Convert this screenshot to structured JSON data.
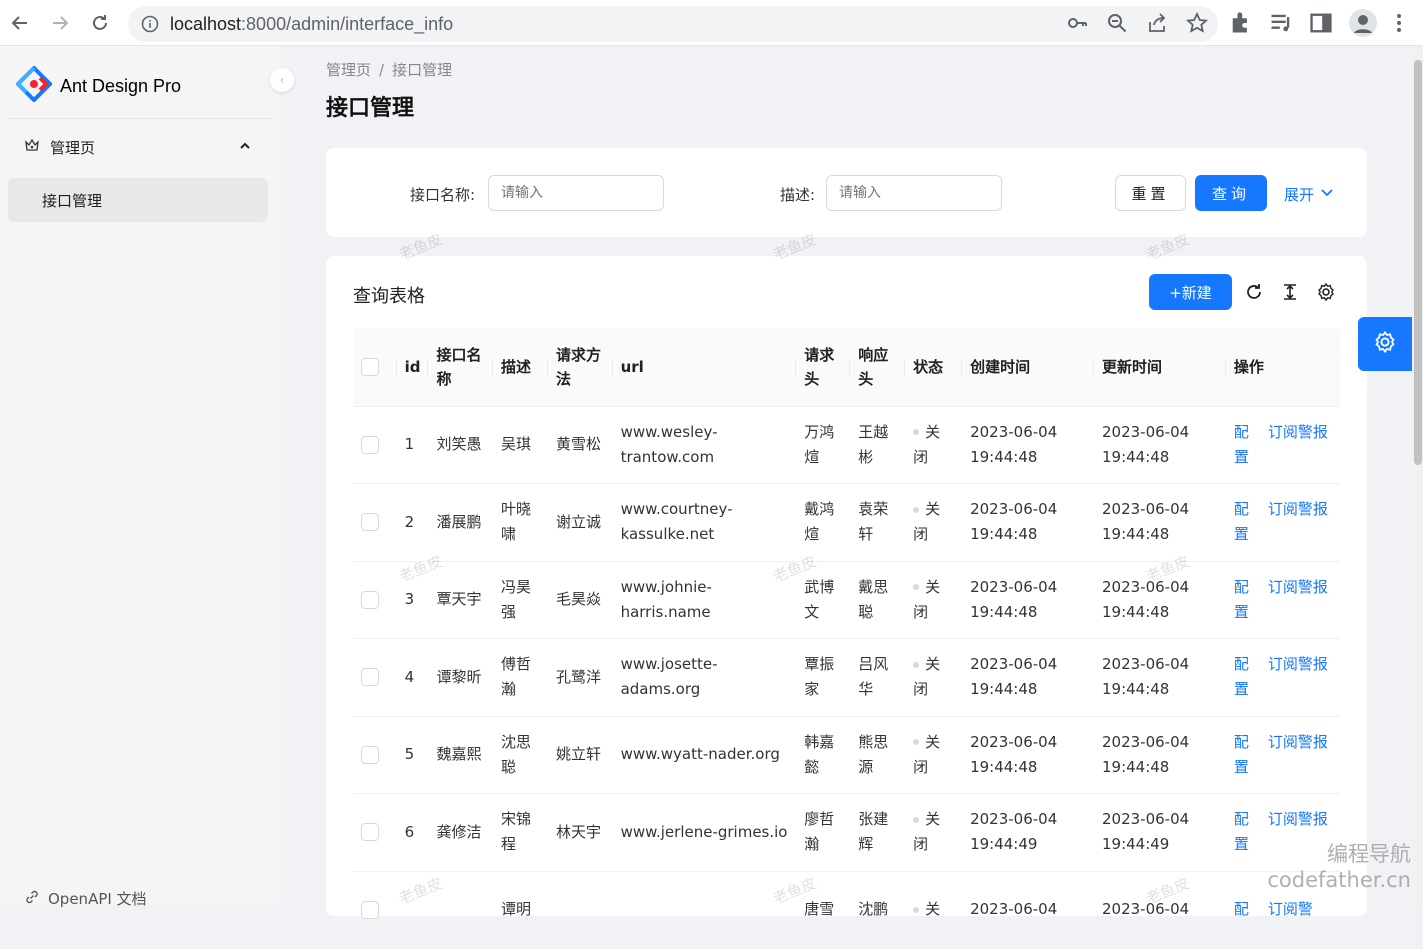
{
  "browser": {
    "url_host": "localhost",
    "url_rest": ":8000/admin/interface_info"
  },
  "sidebar": {
    "logo_text": "Ant Design Pro",
    "menu_group": "管理页",
    "menu_item": "接口管理",
    "footer_link": "OpenAPI 文档"
  },
  "breadcrumb": [
    "管理页",
    "接口管理"
  ],
  "page_title": "接口管理",
  "search": {
    "name_label": "接口名称:",
    "name_placeholder": "请输入",
    "desc_label": "描述:",
    "desc_placeholder": "请输入",
    "reset": "重置",
    "query": "查询",
    "expand": "展开"
  },
  "table": {
    "title": "查询表格",
    "new_button": "+新建",
    "columns": [
      "id",
      "接口名称",
      "描述",
      "请求方法",
      "url",
      "请求头",
      "响应头",
      "状态",
      "创建时间",
      "更新时间",
      "操作"
    ],
    "rows": [
      {
        "id": "1",
        "name": "刘笑愚",
        "desc": "吴琪",
        "method": "黄雪松",
        "url": "www.wesley-trantow.com",
        "req": "万鸿煊",
        "resp": "王越彬",
        "status": "关闭",
        "created": "2023-06-04 19:44:48",
        "updated": "2023-06-04 19:44:48",
        "action1": "配置",
        "action2": "订阅警报"
      },
      {
        "id": "2",
        "name": "潘展鹏",
        "desc": "叶晓啸",
        "method": "谢立诚",
        "url": "www.courtney-kassulke.net",
        "req": "戴鸿煊",
        "resp": "袁荣轩",
        "status": "关闭",
        "created": "2023-06-04 19:44:48",
        "updated": "2023-06-04 19:44:48",
        "action1": "配置",
        "action2": "订阅警报"
      },
      {
        "id": "3",
        "name": "覃天宇",
        "desc": "冯昊强",
        "method": "毛昊焱",
        "url": "www.johnie-harris.name",
        "req": "武博文",
        "resp": "戴思聪",
        "status": "关闭",
        "created": "2023-06-04 19:44:48",
        "updated": "2023-06-04 19:44:48",
        "action1": "配置",
        "action2": "订阅警报"
      },
      {
        "id": "4",
        "name": "谭黎昕",
        "desc": "傅哲瀚",
        "method": "孔鹭洋",
        "url": "www.josette-adams.org",
        "req": "覃振家",
        "resp": "吕风华",
        "status": "关闭",
        "created": "2023-06-04 19:44:48",
        "updated": "2023-06-04 19:44:48",
        "action1": "配置",
        "action2": "订阅警报"
      },
      {
        "id": "5",
        "name": "魏嘉熙",
        "desc": "沈思聪",
        "method": "姚立轩",
        "url": "www.wyatt-nader.org",
        "req": "韩嘉懿",
        "resp": "熊思源",
        "status": "关闭",
        "created": "2023-06-04 19:44:48",
        "updated": "2023-06-04 19:44:48",
        "action1": "配置",
        "action2": "订阅警报"
      },
      {
        "id": "6",
        "name": "龚修洁",
        "desc": "宋锦程",
        "method": "林天宇",
        "url": "www.jerlene-grimes.io",
        "req": "廖哲瀚",
        "resp": "张建辉",
        "status": "关闭",
        "created": "2023-06-04 19:44:49",
        "updated": "2023-06-04 19:44:49",
        "action1": "配置",
        "action2": "订阅警报"
      },
      {
        "id": "",
        "name": "",
        "desc": "谭明",
        "method": "",
        "url": "",
        "req": "唐雪",
        "resp": "沈鹏",
        "status": "关",
        "created": "2023-06-04",
        "updated": "2023-06-04",
        "action1": "配",
        "action2": "订阅警"
      }
    ]
  },
  "watermark": "老鱼皮",
  "corner_watermark": [
    "编程导航",
    "codefather.cn"
  ]
}
